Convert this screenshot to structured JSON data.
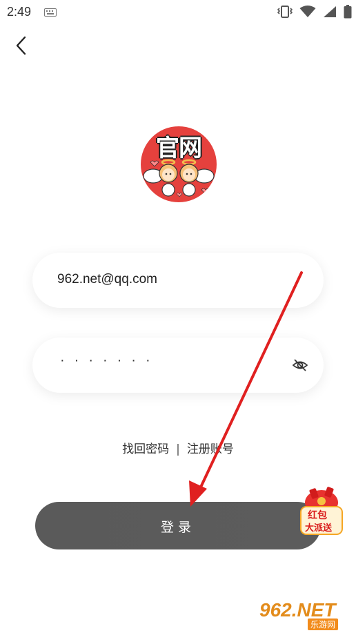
{
  "status_bar": {
    "time": "2:49",
    "icons": [
      "keyboard-icon",
      "vibrate-icon",
      "wifi-icon",
      "signal-icon",
      "battery-icon"
    ]
  },
  "back": {
    "icon": "chevron-left-icon"
  },
  "logo": {
    "text": "官网",
    "brand_color": "#e5413d"
  },
  "form": {
    "email_value": "962.net@qq.com",
    "password_mask": "·······",
    "eye_icon": "eye-off-icon"
  },
  "links": {
    "forgot": "找回密码",
    "separator": "|",
    "register": "注册账号"
  },
  "login": {
    "label": "登录",
    "color": "#5a5a5a"
  },
  "red_packet": {
    "line1": "红包",
    "line2": "大派送"
  },
  "annotation": {
    "arrow_color": "#e02020"
  },
  "watermark": {
    "main": "962.NET",
    "sub": "乐游网"
  }
}
